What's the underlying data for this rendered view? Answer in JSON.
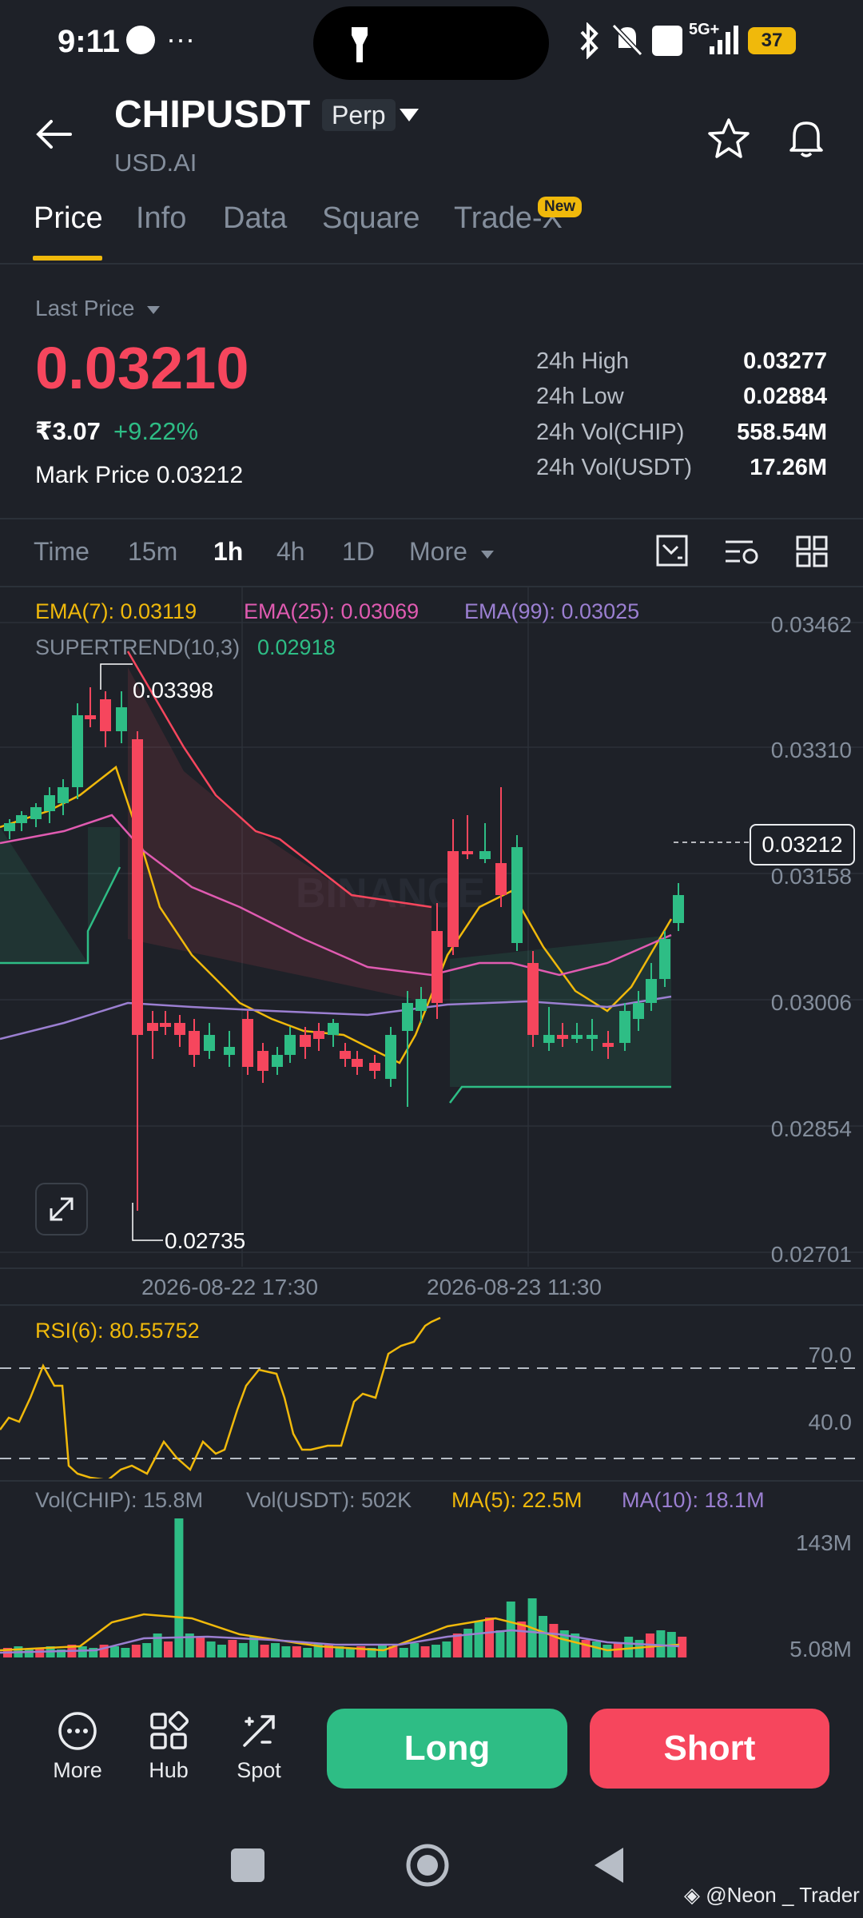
{
  "status_bar": {
    "time": "9:11",
    "more": "···",
    "battery": "37",
    "network": "5G+"
  },
  "header": {
    "symbol": "CHIPUSDT",
    "contract_type": "Perp",
    "subtitle": "USD.AI"
  },
  "tabs": [
    {
      "label": "Price",
      "active": true
    },
    {
      "label": "Info"
    },
    {
      "label": "Data"
    },
    {
      "label": "Square"
    },
    {
      "label": "Trade-X",
      "badge": "New"
    }
  ],
  "ticker": {
    "last_price_label": "Last Price",
    "last_price": "0.03210",
    "fiat_price": "₹3.07",
    "change": "+9.22%",
    "mark_price_label": "Mark Price",
    "mark_price": "0.03212",
    "stats": [
      {
        "label": "24h High",
        "value": "0.03277"
      },
      {
        "label": "24h Low",
        "value": "0.02884"
      },
      {
        "label": "24h Vol(CHIP)",
        "value": "558.54M"
      },
      {
        "label": "24h Vol(USDT)",
        "value": "17.26M"
      }
    ]
  },
  "timeframes": [
    {
      "label": "Time"
    },
    {
      "label": "15m"
    },
    {
      "label": "1h",
      "active": true
    },
    {
      "label": "4h"
    },
    {
      "label": "1D"
    },
    {
      "label": "More"
    }
  ],
  "indicators": {
    "ema7": "EMA(7): 0.03119",
    "ema25": "EMA(25): 0.03069",
    "ema99": "EMA(99): 0.03025",
    "supertrend_label": "SUPERTREND(10,3)",
    "supertrend_value": "0.02918"
  },
  "price_axis": [
    "0.03462",
    "0.03310",
    "0.03158",
    "0.03006",
    "0.02854",
    "0.02701"
  ],
  "current_price_tag": "0.03212",
  "chart_high_label": "0.03398",
  "chart_low_label": "0.02735",
  "watermark": "BINANCE",
  "time_axis": [
    "2026-08-22 17:30",
    "2026-08-23 11:30"
  ],
  "rsi": {
    "label": "RSI(6): 80.55752",
    "levels": [
      "70.0",
      "40.0"
    ]
  },
  "volume": {
    "vol_chip": "Vol(CHIP): 15.8M",
    "vol_usdt": "Vol(USDT): 502K",
    "ma5": "MA(5): 22.5M",
    "ma10": "MA(10): 18.1M",
    "axis_top": "143M",
    "axis_bottom": "5.08M"
  },
  "bottom_nav": [
    {
      "label": "More",
      "icon": "dots-circle-icon"
    },
    {
      "label": "Hub",
      "icon": "grid-hub-icon"
    },
    {
      "label": "Spot",
      "icon": "spot-arrows-icon"
    }
  ],
  "actions": {
    "long": "Long",
    "short": "Short"
  },
  "credit": "@Neon _ Trader",
  "colors": {
    "up": "#2ebd85",
    "down": "#f6465d",
    "accent": "#f0b90b",
    "ema7": "#f0b90b",
    "ema25": "#e05bb1",
    "ema99": "#9b7fd1",
    "supertrend": "#2ebd85"
  }
}
